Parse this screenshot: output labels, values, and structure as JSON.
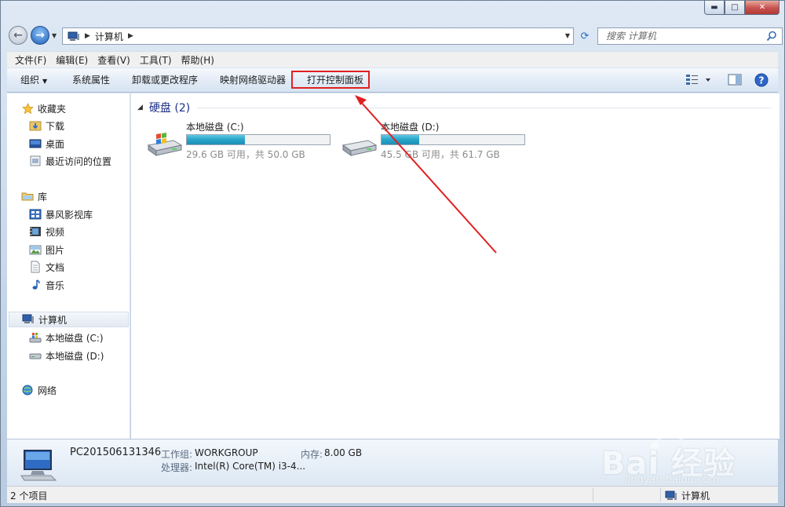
{
  "window": {
    "controls": {
      "minimize": "▬",
      "maximize": "□",
      "close": "✕"
    }
  },
  "address_bar": {
    "location": "计算机",
    "search_placeholder": "搜索 计算机"
  },
  "menu": [
    "文件(F)",
    "编辑(E)",
    "查看(V)",
    "工具(T)",
    "帮助(H)"
  ],
  "commands": {
    "organize": "组织",
    "system_properties": "系统属性",
    "uninstall": "卸载或更改程序",
    "map_drive": "映射网络驱动器",
    "open_control_panel": "打开控制面板"
  },
  "nav": {
    "favorites": "收藏夹",
    "downloads": "下载",
    "desktop": "桌面",
    "recent": "最近访问的位置",
    "libraries": "库",
    "storm": "暴风影视库",
    "videos": "视频",
    "pictures": "图片",
    "documents": "文档",
    "music": "音乐",
    "computer": "计算机",
    "drive_c": "本地磁盘 (C:)",
    "drive_d": "本地磁盘 (D:)",
    "network": "网络"
  },
  "group": {
    "title": "硬盘 (2)"
  },
  "drives": [
    {
      "name": "本地磁盘 (C:)",
      "info": "29.6 GB 可用，共 50.0 GB",
      "used_fraction": 0.408
    },
    {
      "name": "本地磁盘 (D:)",
      "info": "45.5 GB 可用，共 61.7 GB",
      "used_fraction": 0.263
    }
  ],
  "details": {
    "pc_name": "PC201506131346",
    "workgroup_label": "工作组:",
    "workgroup_value": "WORKGROUP",
    "memory_label": "内存:",
    "memory_value": "8.00 GB",
    "cpu_label": "处理器:",
    "cpu_value": "Intel(R) Core(TM) i3-4..."
  },
  "status": {
    "items": "2 个项目",
    "location": "计算机"
  },
  "watermark": {
    "brand": "Bai 经验",
    "url": "jingyan.baidu.com"
  },
  "colors": {
    "annotation": "#e02020",
    "link_blue": "#1e3287",
    "drive_fill": "#28a3c7"
  }
}
